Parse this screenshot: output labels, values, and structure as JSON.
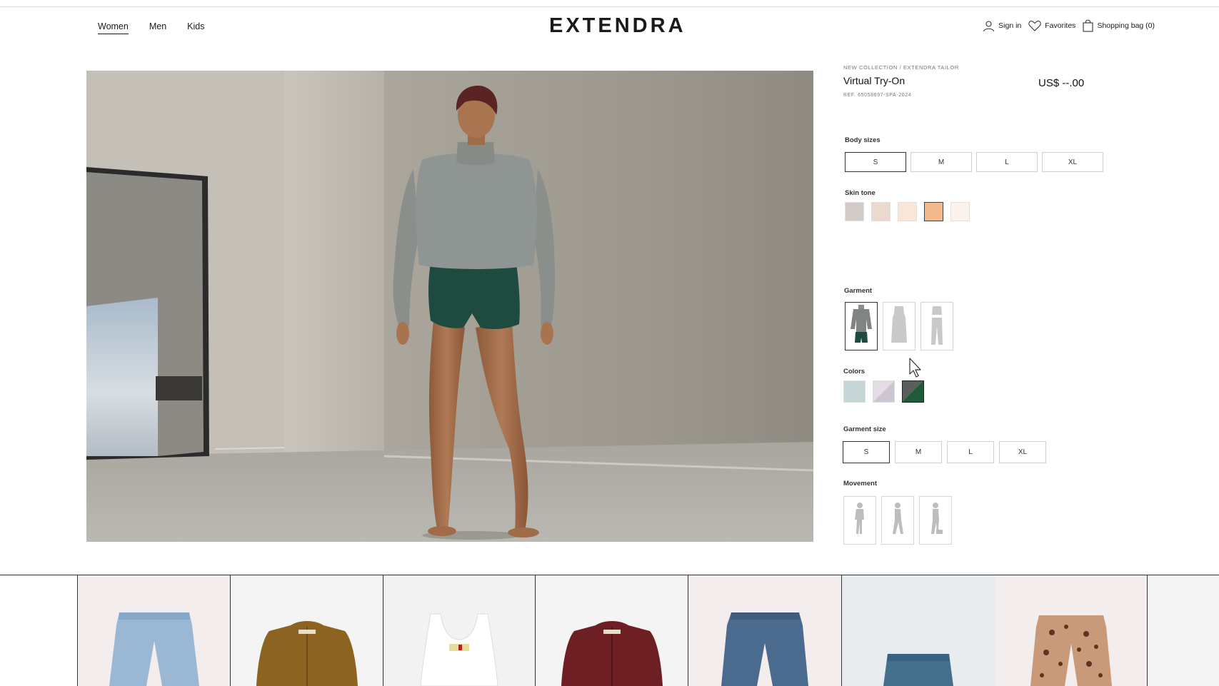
{
  "nav": {
    "items": [
      "Women",
      "Men",
      "Kids"
    ],
    "active": "Women"
  },
  "brand": {
    "logo": "EXTENDRA"
  },
  "utility": {
    "signin": "Sign in",
    "favorites": "Favorites",
    "bag": "Shopping bag (0)"
  },
  "product": {
    "breadcrumb": "NEW COLLECTION / EXTENDRA TAILOR",
    "title": "Virtual Try-On",
    "ref": "REF. 65058697-SPA-2024",
    "price": "US$ --.00"
  },
  "body_sizes": {
    "label": "Body sizes",
    "options": [
      "S",
      "M",
      "L",
      "XL"
    ],
    "selected": "S"
  },
  "skin_tone": {
    "label": "Skin tone",
    "swatches": [
      "#d3cbc8",
      "#ebd8cf",
      "#f8e7d8",
      "#f2b98f",
      "#fbf3ec"
    ],
    "selected_index": 3
  },
  "garment": {
    "label": "Garment",
    "options": [
      "sweater-and-shorts-icon",
      "dress-icon",
      "top-and-pants-icon"
    ],
    "selected_index": 0
  },
  "colors": {
    "label": "Colors",
    "swatches": [
      "#c6d6d6",
      "#d7d0da",
      "#1f5a3a"
    ],
    "selected_index": 2
  },
  "garment_size": {
    "label": "Garment size",
    "options": [
      "S",
      "M",
      "L",
      "XL"
    ],
    "selected": "S"
  },
  "movement": {
    "label": "Movement",
    "options": [
      "pose-standing-icon",
      "pose-walking-icon",
      "pose-stepping-icon"
    ]
  },
  "products": [
    {
      "type": "empty",
      "bg": "#ffffff"
    },
    {
      "type": "jeans",
      "bg": "#f3eded",
      "color": "#9ab8d4"
    },
    {
      "type": "cardigan",
      "bg": "#f4f4f4",
      "color": "#8c6320"
    },
    {
      "type": "tank",
      "bg": "#f2f2f2",
      "color": "#ffffff"
    },
    {
      "type": "cardigan",
      "bg": "#f4f4f4",
      "color": "#6e1f24"
    },
    {
      "type": "jeans",
      "bg": "#f3eded",
      "color": "#4a6b8e"
    },
    {
      "type": "shorts",
      "bg": "#e8ecef",
      "color": "#44708e"
    },
    {
      "type": "leopard",
      "bg": "#f3eded",
      "color": "#c99a7a"
    },
    {
      "type": "empty",
      "bg": "#f4f4f4"
    }
  ]
}
